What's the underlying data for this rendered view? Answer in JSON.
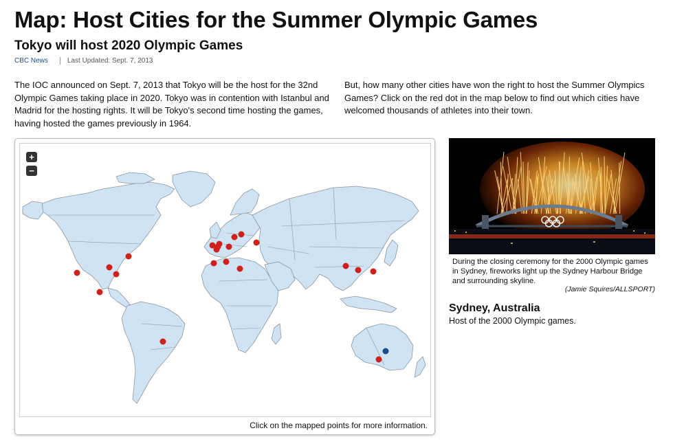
{
  "header": {
    "title": "Map: Host Cities for the Summer Olympic Games",
    "subtitle": "Tokyo will host 2020 Olympic Games",
    "source": "CBC News",
    "updated": "Last Updated: Sept. 7, 2013"
  },
  "intro": {
    "left": "The IOC announced on Sept. 7, 2013 that Tokyo will be the host for the 32nd Olympic Games taking place in 2020. Tokyo was in contention with Istanbul and Madrid for the hosting rights. It will be Tokyo's second time hosting the games, having hosted the games previously in 1964.",
    "right": "But, how many other cities have won the right to host the Summer Olympics Games? Click on the red dot in the map below to find out which cities have welcomed thousands of athletes into their town."
  },
  "map": {
    "zoom_in": "+",
    "zoom_out": "−",
    "note": "Click on the mapped points for more information.",
    "colors": {
      "land": "#cfe3f3",
      "border": "#8a96a3",
      "marker": "#d0201c",
      "selected": "#1b4f8b"
    }
  },
  "detail": {
    "photo_icon": "sydney-harbour-fireworks-photo",
    "caption": "During the closing ceremony for the 2000 Olympic games in Sydney, fireworks light up the Sydney Harbour Bridge and surrounding skyline.",
    "credit": "(Jamie Squires/ALLSPORT)",
    "city": "Sydney, Australia",
    "host_text": "Host of the 2000 Olympic games."
  }
}
